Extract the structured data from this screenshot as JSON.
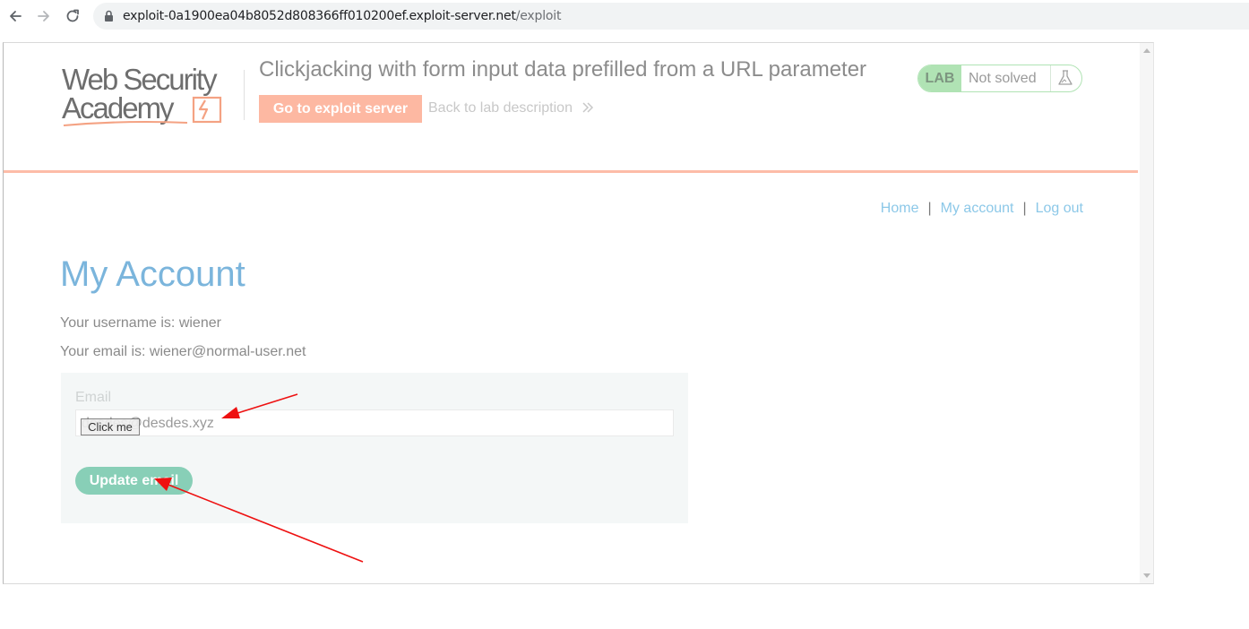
{
  "browser": {
    "url_host": "exploit-0a1900ea04b8052d808366ff010200ef.exploit-server.net",
    "url_path": "/exploit"
  },
  "lab": {
    "logo_line1": "Web Security",
    "logo_line2": "Academy",
    "title": "Clickjacking with form input data prefilled from a URL parameter",
    "exploit_button": "Go to exploit server",
    "back_link": "Back to lab description",
    "badge_tag": "LAB",
    "badge_status": "Not solved"
  },
  "nav": {
    "home": "Home",
    "separator": "|",
    "my_account": "My account",
    "log_out": "Log out"
  },
  "account": {
    "title": "My Account",
    "username_line": "Your username is: wiener",
    "email_line": "Your email is: wiener@normal-user.net",
    "email_label": "Email",
    "email_value": "desdes@desdes.xyz",
    "update_button": "Update email",
    "decoy_button": "Click me"
  },
  "colors": {
    "accent_orange": "#fdb8a2",
    "link_blue": "#8cc8e8",
    "title_blue": "#7bb5dc",
    "button_green": "#88cfb7",
    "lab_badge_green": "#b0e3b4",
    "annotation_red": "#ee1111"
  },
  "icons": {
    "back": "arrow-left-icon",
    "forward": "arrow-right-icon",
    "reload": "reload-icon",
    "lock": "lock-icon",
    "flask": "flask-icon",
    "chevron": "double-chevron-right-icon"
  }
}
